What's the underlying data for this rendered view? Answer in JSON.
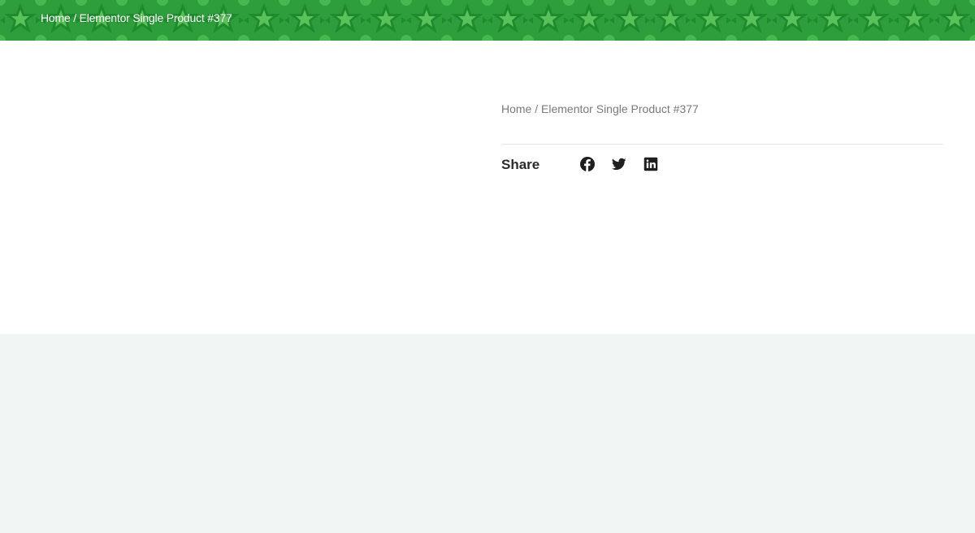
{
  "banner": {
    "breadcrumb": {
      "home": "Home",
      "separator": " / ",
      "current": "Elementor Single Product #377"
    },
    "pattern_colors": [
      "#2e9e3c",
      "#1f8a2e",
      "#45b84f",
      "#5ac25a"
    ]
  },
  "product": {
    "breadcrumb": {
      "home": "Home",
      "separator": " / ",
      "current": "Elementor Single Product #377"
    },
    "share": {
      "label": "Share",
      "icons": [
        "facebook-icon",
        "twitter-icon",
        "linkedin-icon"
      ]
    }
  },
  "colors": {
    "banner_green": "#2e9e3c",
    "text_dark": "#2b2b2b",
    "text_muted": "#7a7a7a",
    "footer_bg": "#f1f5f4"
  }
}
